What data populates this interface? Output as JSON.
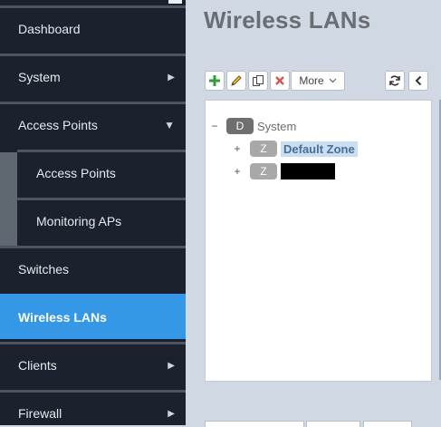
{
  "sidebar": {
    "items": [
      {
        "label": "Dashboard"
      },
      {
        "label": "System",
        "arrow": "▶"
      },
      {
        "label": "Access Points",
        "arrow": "▼"
      },
      {
        "label": "Access Points"
      },
      {
        "label": "Monitoring APs"
      },
      {
        "label": "Switches"
      },
      {
        "label": "Wireless LANs"
      },
      {
        "label": "Clients",
        "arrow": "▶"
      },
      {
        "label": "Firewall",
        "arrow": "▶"
      }
    ]
  },
  "main": {
    "title": "Wireless LANs",
    "toolbar": {
      "add_icon": "plus-icon",
      "edit_icon": "pencil-icon",
      "clone_icon": "copy-icon",
      "delete_icon": "x-icon",
      "more_label": "More",
      "refresh_icon": "refresh-icon",
      "collapse_icon": "chevron-left-icon"
    },
    "tree": [
      {
        "toggle": "−",
        "badge": "D",
        "label": "System"
      },
      {
        "toggle": "+",
        "badge": "Z",
        "label": "Default Zone"
      },
      {
        "toggle": "+",
        "badge": "Z",
        "label": ""
      }
    ]
  },
  "colors": {
    "sidebar_bg": "#1c222d",
    "active": "#3598e6",
    "main_bg": "#d0d8e3",
    "add": "#2e9e3a",
    "delete": "#d9534f"
  }
}
